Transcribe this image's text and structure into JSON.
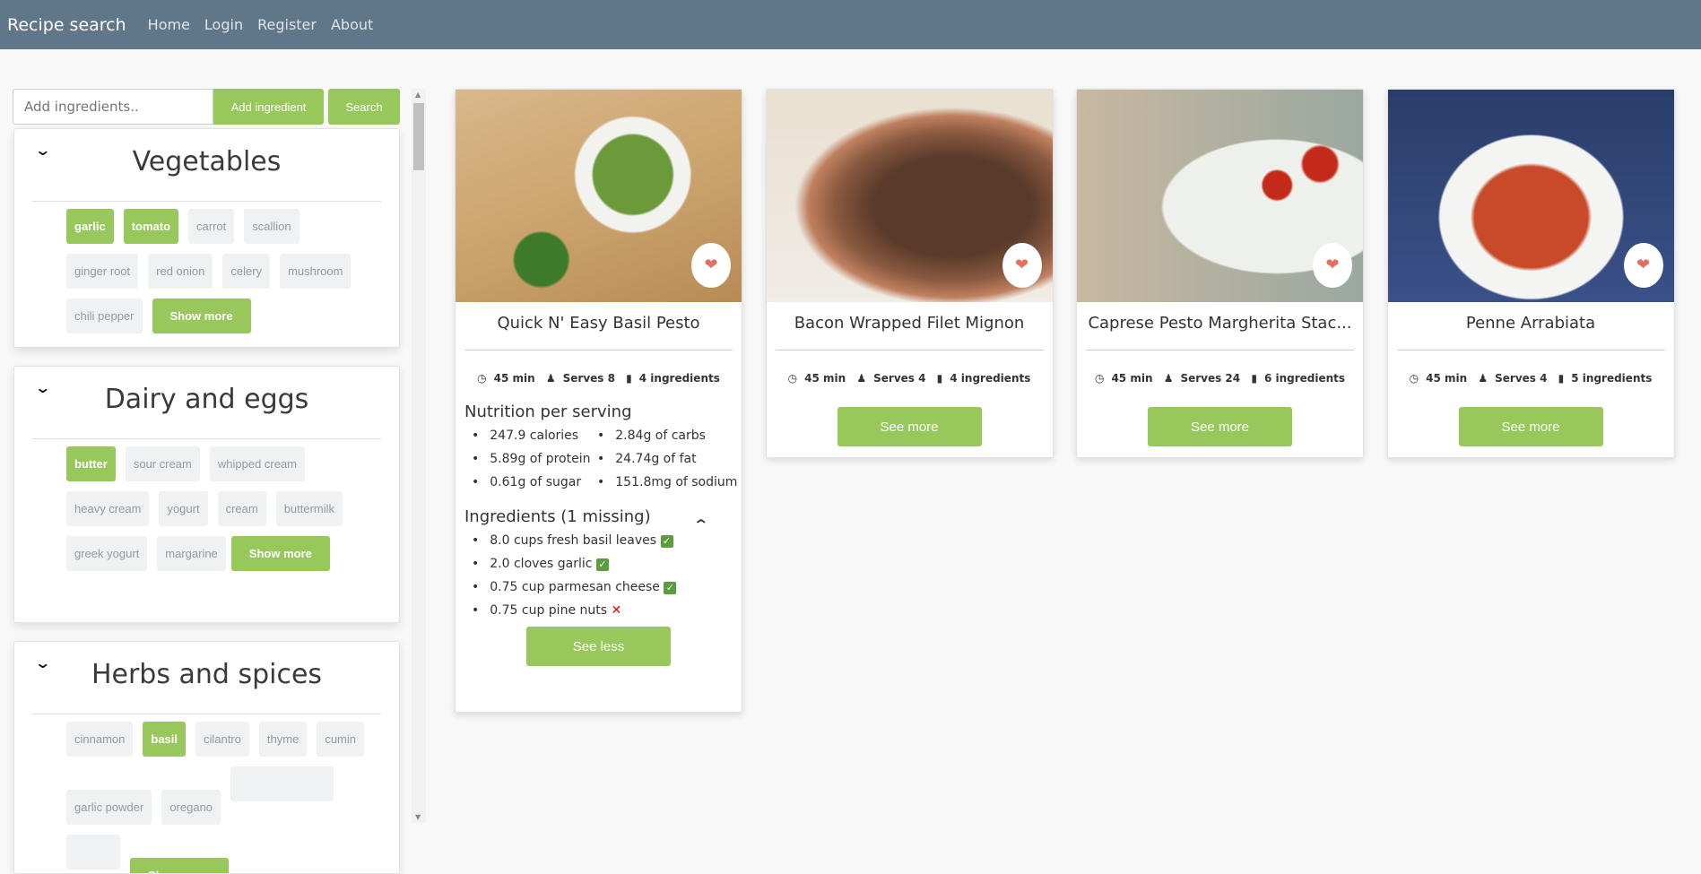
{
  "navbar": {
    "brand": "Recipe search",
    "links": [
      "Home",
      "Login",
      "Register",
      "About"
    ]
  },
  "search": {
    "placeholder": "Add ingredients..",
    "add_label": "Add ingredient",
    "search_label": "Search"
  },
  "categories": [
    {
      "title": "Vegetables",
      "items": [
        {
          "name": "garlic",
          "selected": true
        },
        {
          "name": "tomato",
          "selected": true
        },
        {
          "name": "carrot"
        },
        {
          "name": "scallion"
        },
        {
          "name": "ginger root"
        },
        {
          "name": "red onion"
        },
        {
          "name": "celery"
        },
        {
          "name": "mushroom"
        },
        {
          "name": "chili pepper"
        }
      ],
      "more": "Show more"
    },
    {
      "title": "Dairy and eggs",
      "items": [
        {
          "name": "butter",
          "selected": true
        },
        {
          "name": "sour cream"
        },
        {
          "name": "whipped cream"
        },
        {
          "name": "heavy cream"
        },
        {
          "name": "yogurt"
        },
        {
          "name": "cream"
        },
        {
          "name": "buttermilk"
        },
        {
          "name": "greek yogurt"
        },
        {
          "name": "margarine"
        }
      ],
      "more": "Show more"
    },
    {
      "title": "Herbs and spices",
      "items": [
        {
          "name": "cinnamon"
        },
        {
          "name": "basil",
          "selected": true
        },
        {
          "name": "cilantro"
        },
        {
          "name": "thyme"
        },
        {
          "name": "cumin"
        },
        {
          "name": "garlic powder"
        },
        {
          "name": "oregano"
        }
      ],
      "more": "Show more"
    }
  ],
  "recipes": [
    {
      "title": "Quick N' Easy Basil Pesto",
      "time": "45 min",
      "serves": "Serves 8",
      "ingredients_count": "4 ingredients",
      "expanded": true,
      "nutrition_title": "Nutrition per serving",
      "nutrition": [
        "247.9 calories",
        "2.84g of carbs",
        "5.89g of protein",
        "24.74g of fat",
        "0.61g of sugar",
        "151.8mg of sodium"
      ],
      "ingredients_title": "Ingredients (1 missing)",
      "ingredients": [
        {
          "text": "8.0 cups fresh basil leaves",
          "have": true
        },
        {
          "text": "2.0 cloves garlic",
          "have": true
        },
        {
          "text": "0.75 cup parmesan cheese",
          "have": true
        },
        {
          "text": "0.75 cup pine nuts",
          "have": false
        }
      ],
      "button": "See less"
    },
    {
      "title": "Bacon Wrapped Filet Mignon",
      "time": "45 min",
      "serves": "Serves 4",
      "ingredients_count": "4 ingredients",
      "button": "See more"
    },
    {
      "title": "Caprese Pesto Margherita Stac...",
      "time": "45 min",
      "serves": "Serves 24",
      "ingredients_count": "6 ingredients",
      "button": "See more"
    },
    {
      "title": "Penne Arrabiata",
      "time": "45 min",
      "serves": "Serves 4",
      "ingredients_count": "5 ingredients",
      "button": "See more"
    }
  ],
  "colors": {
    "navbar": "#607689",
    "accent": "#98c85c",
    "heart": "#e07060"
  }
}
